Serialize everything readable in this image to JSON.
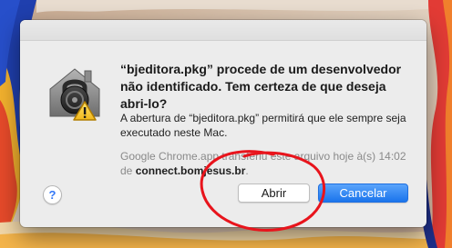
{
  "dialog": {
    "icon": "security-lock-warning-icon",
    "heading": "“bjeditora.pkg” procede de um desenvolvedor não identificado. Tem certeza de que deseja abri-lo?",
    "body": "A abertura de “bjeditora.pkg” permitirá que ele sempre seja executado neste Mac.",
    "source_prefix": "Google Chrome.app transferiu este arquivo hoje à(s) 14:02 de ",
    "source_host": "connect.bomjesus.br",
    "source_suffix": ".",
    "help_label": "?",
    "open_label": "Abrir",
    "cancel_label": "Cancelar"
  },
  "colors": {
    "accent": "#1a74ec",
    "annotation": "#e8141c"
  }
}
